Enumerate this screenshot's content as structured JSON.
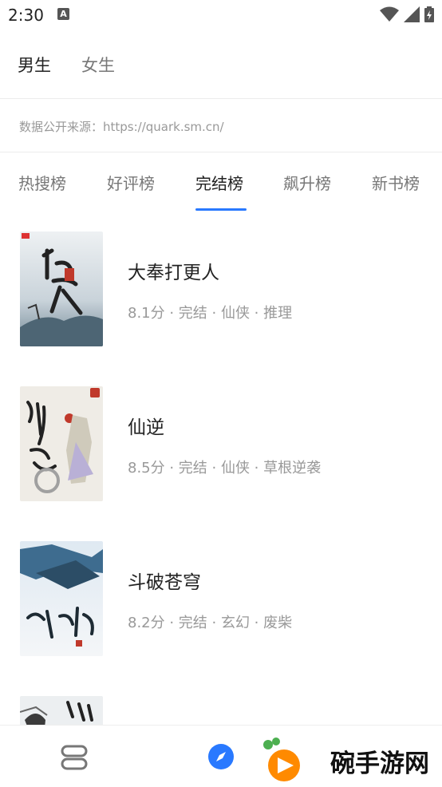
{
  "status_bar": {
    "time": "2:30",
    "notification_icon": "a-icon"
  },
  "gender_tabs": [
    {
      "label": "男生",
      "active": true
    },
    {
      "label": "女生",
      "active": false
    }
  ],
  "source_text": "数据公开来源：https://quark.sm.cn/",
  "rank_tabs": [
    {
      "label": "热搜榜",
      "active": false
    },
    {
      "label": "好评榜",
      "active": false
    },
    {
      "label": "完结榜",
      "active": true
    },
    {
      "label": "飙升榜",
      "active": false
    },
    {
      "label": "新书榜",
      "active": false
    }
  ],
  "books": [
    {
      "title": "大奉打更人",
      "meta": "8.1分 · 完结 · 仙侠 · 推理"
    },
    {
      "title": "仙逆",
      "meta": "8.5分 · 完结 · 仙侠 · 草根逆袭"
    },
    {
      "title": "斗破苍穹",
      "meta": "8.2分 · 完结 · 玄幻 · 废柴"
    },
    {
      "title": "",
      "meta": ""
    }
  ],
  "bottom_nav": {
    "items": [
      {
        "icon": "bookshelf-icon"
      },
      {
        "icon": "compass-icon"
      }
    ],
    "watermark_text": "碗手游网"
  },
  "colors": {
    "accent": "#2979ff",
    "watermark_orange": "#ff8a00",
    "watermark_green": "#4caf50"
  }
}
